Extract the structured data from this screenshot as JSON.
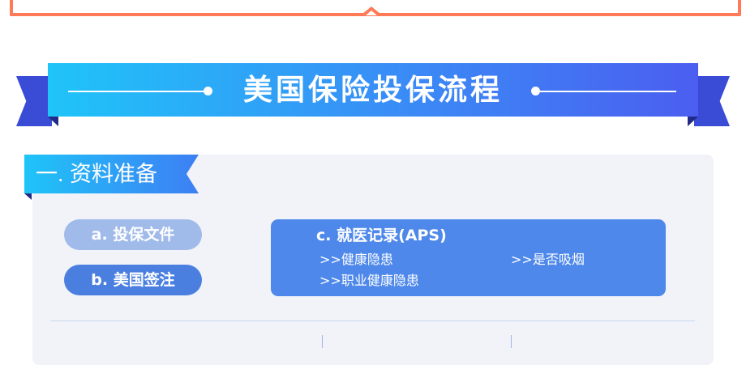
{
  "banner": {
    "title": "美国保险投保流程"
  },
  "section": {
    "title": "一. 资料准备"
  },
  "documents": {
    "item_a": "a. 投保文件",
    "item_b": "b. 美国签注"
  },
  "aps_card": {
    "title": "c. 就医记录(APS)",
    "items": [
      ">>健康隐患",
      ">>是否吸烟",
      ">>职业健康隐患"
    ]
  },
  "colors": {
    "accent_orange": "#ff7a57",
    "ribbon_start": "#1fc4f8",
    "ribbon_end": "#4b5ef0",
    "ribbon_tail": "#3a4bd6",
    "panel_bg": "#f1f3f9",
    "pill_light": "#a0bbea",
    "pill_dark": "#4a7fe0",
    "card_bg": "#4e88ea"
  }
}
